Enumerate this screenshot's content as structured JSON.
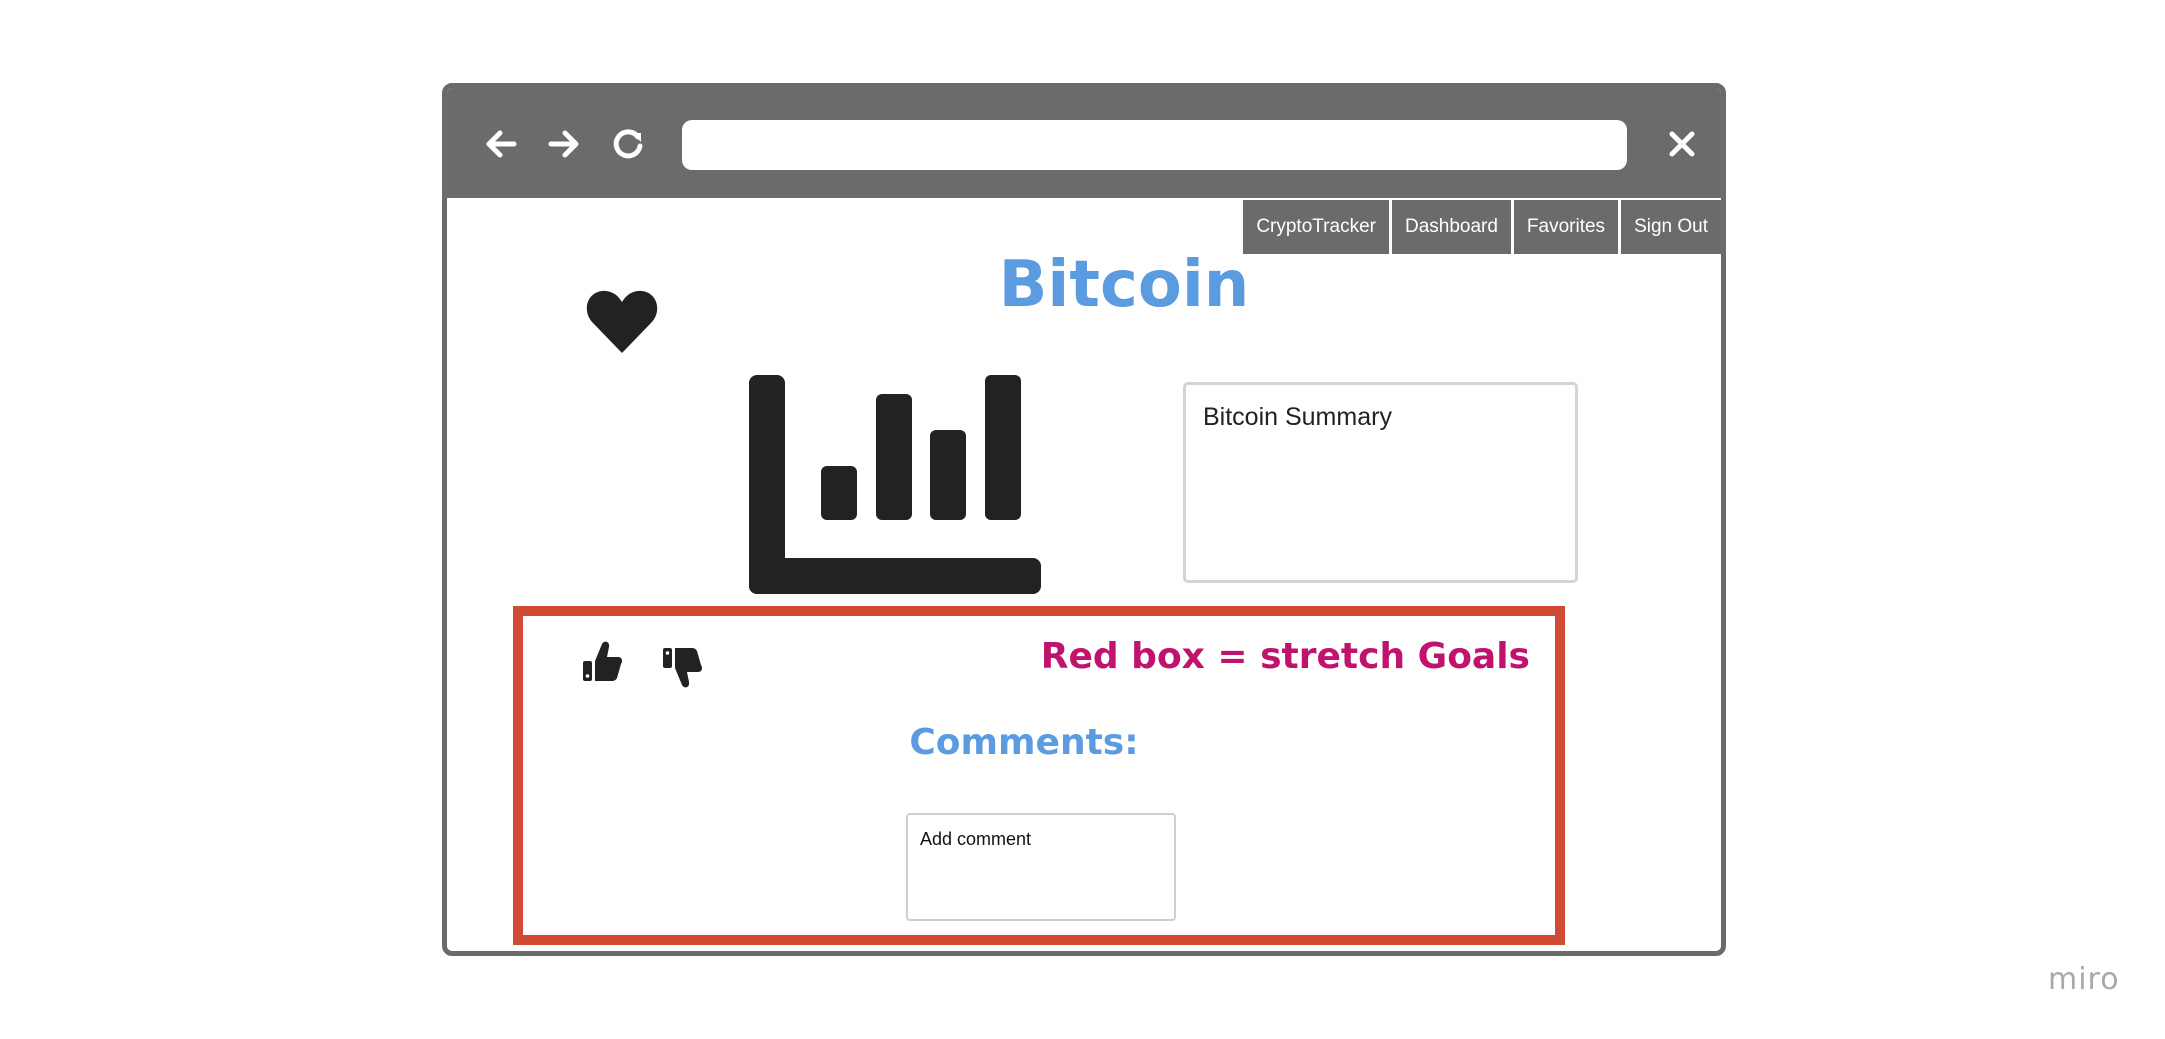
{
  "browser": {
    "icons": {
      "back": "arrow-left-icon",
      "forward": "arrow-right-icon",
      "reload": "reload-icon",
      "close": "close-icon"
    },
    "address_value": ""
  },
  "menu": {
    "items": [
      {
        "label": "CryptoTracker"
      },
      {
        "label": "Dashboard"
      },
      {
        "label": "Favorites"
      },
      {
        "label": "Sign Out"
      }
    ]
  },
  "page": {
    "title": "Bitcoin",
    "favorite_icon": "heart-icon",
    "chart_icon": "bar-chart-icon",
    "summary": "Bitcoin Summary"
  },
  "stretch": {
    "note": "Red box = stretch Goals",
    "like_icon": "thumbs-up-icon",
    "dislike_icon": "thumbs-down-icon",
    "comments_label": "Comments:",
    "comment_placeholder": "Add comment"
  },
  "watermark": "miro",
  "colors": {
    "chrome": "#6b6b6b",
    "title_blue": "#5b9be0",
    "stretch_border": "#d24a33",
    "stretch_text": "#c0136e",
    "icon_dark": "#222222"
  }
}
